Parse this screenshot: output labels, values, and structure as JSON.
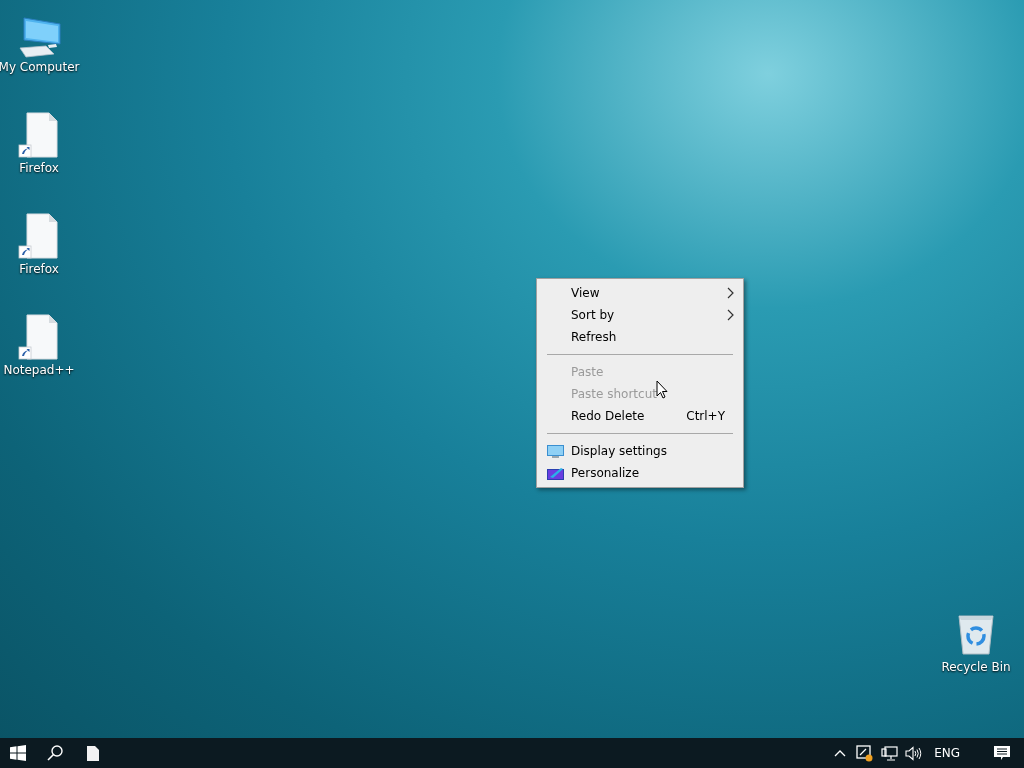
{
  "desktop_icons": [
    {
      "label": "My Computer",
      "kind": "computer"
    },
    {
      "label": "Firefox",
      "kind": "shortcut"
    },
    {
      "label": "Firefox",
      "kind": "shortcut"
    },
    {
      "label": "Notepad++",
      "kind": "shortcut"
    }
  ],
  "recycle_bin": {
    "label": "Recycle Bin"
  },
  "context_menu": {
    "items": [
      {
        "kind": "item",
        "label": "View",
        "has_submenu": true,
        "disabled": false
      },
      {
        "kind": "item",
        "label": "Sort by",
        "has_submenu": true,
        "disabled": false
      },
      {
        "kind": "item",
        "label": "Refresh",
        "has_submenu": false,
        "disabled": false
      },
      {
        "kind": "separator"
      },
      {
        "kind": "item",
        "label": "Paste",
        "has_submenu": false,
        "disabled": true
      },
      {
        "kind": "item",
        "label": "Paste shortcut",
        "has_submenu": false,
        "disabled": true
      },
      {
        "kind": "item",
        "label": "Redo Delete",
        "shortcut": "Ctrl+Y",
        "has_submenu": false,
        "disabled": false
      },
      {
        "kind": "separator"
      },
      {
        "kind": "display",
        "label": "Display settings",
        "has_submenu": false,
        "disabled": false
      },
      {
        "kind": "personalize",
        "label": "Personalize",
        "has_submenu": false,
        "disabled": false
      }
    ]
  },
  "taskbar": {
    "language": "ENG"
  }
}
